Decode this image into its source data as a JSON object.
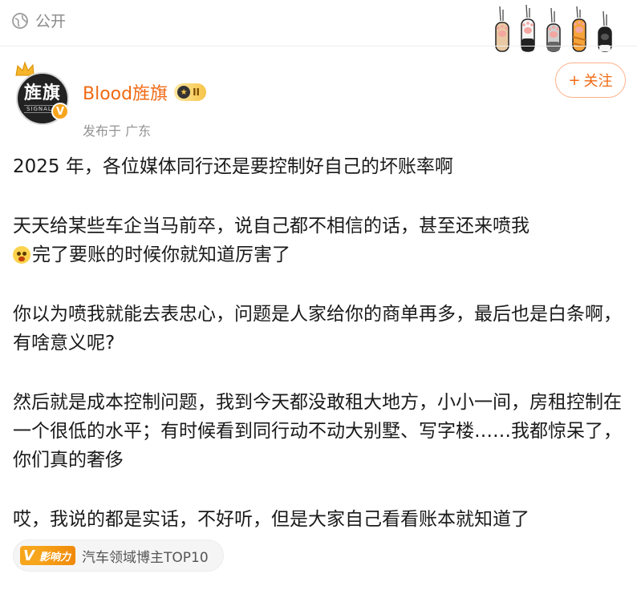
{
  "header": {
    "visibility_label": "公开"
  },
  "author": {
    "name": "Blood旌旗",
    "avatar_text": "旌旗",
    "avatar_subtext": "SIGNAL F",
    "level_badge": "II",
    "verified_mark": "V",
    "location": "发布于 广东"
  },
  "follow_button": {
    "icon": "+",
    "label": "关注"
  },
  "post": {
    "paragraphs": [
      "2025 年，各位媒体同行还是要控制好自己的坏账率啊",
      "天天给某些车企当马前卒，说自己都不相信的话，甚至还来喷我",
      "完了要账的时候你就知道厉害了",
      "你以为喷我就能去表忠心，问题是人家给你的商单再多，最后也是白条啊，有啥意义呢?",
      "然后就是成本控制问题，我到今天都没敢租大地方，小小一间，房租控制在一个很低的水平；有时候看到同行动不动大别墅、写字楼……我都惊呆了，你们真的奢侈",
      "哎，我说的都是实话，不好听，但是大家自己看看账本就知道了"
    ]
  },
  "influence_tag": {
    "badge_v": "V",
    "badge_text": "影响力",
    "label": "汽车领域博主TOP10"
  },
  "colors": {
    "accent": "#f06a14",
    "muted": "#939393",
    "badge": "#f7a51c"
  }
}
